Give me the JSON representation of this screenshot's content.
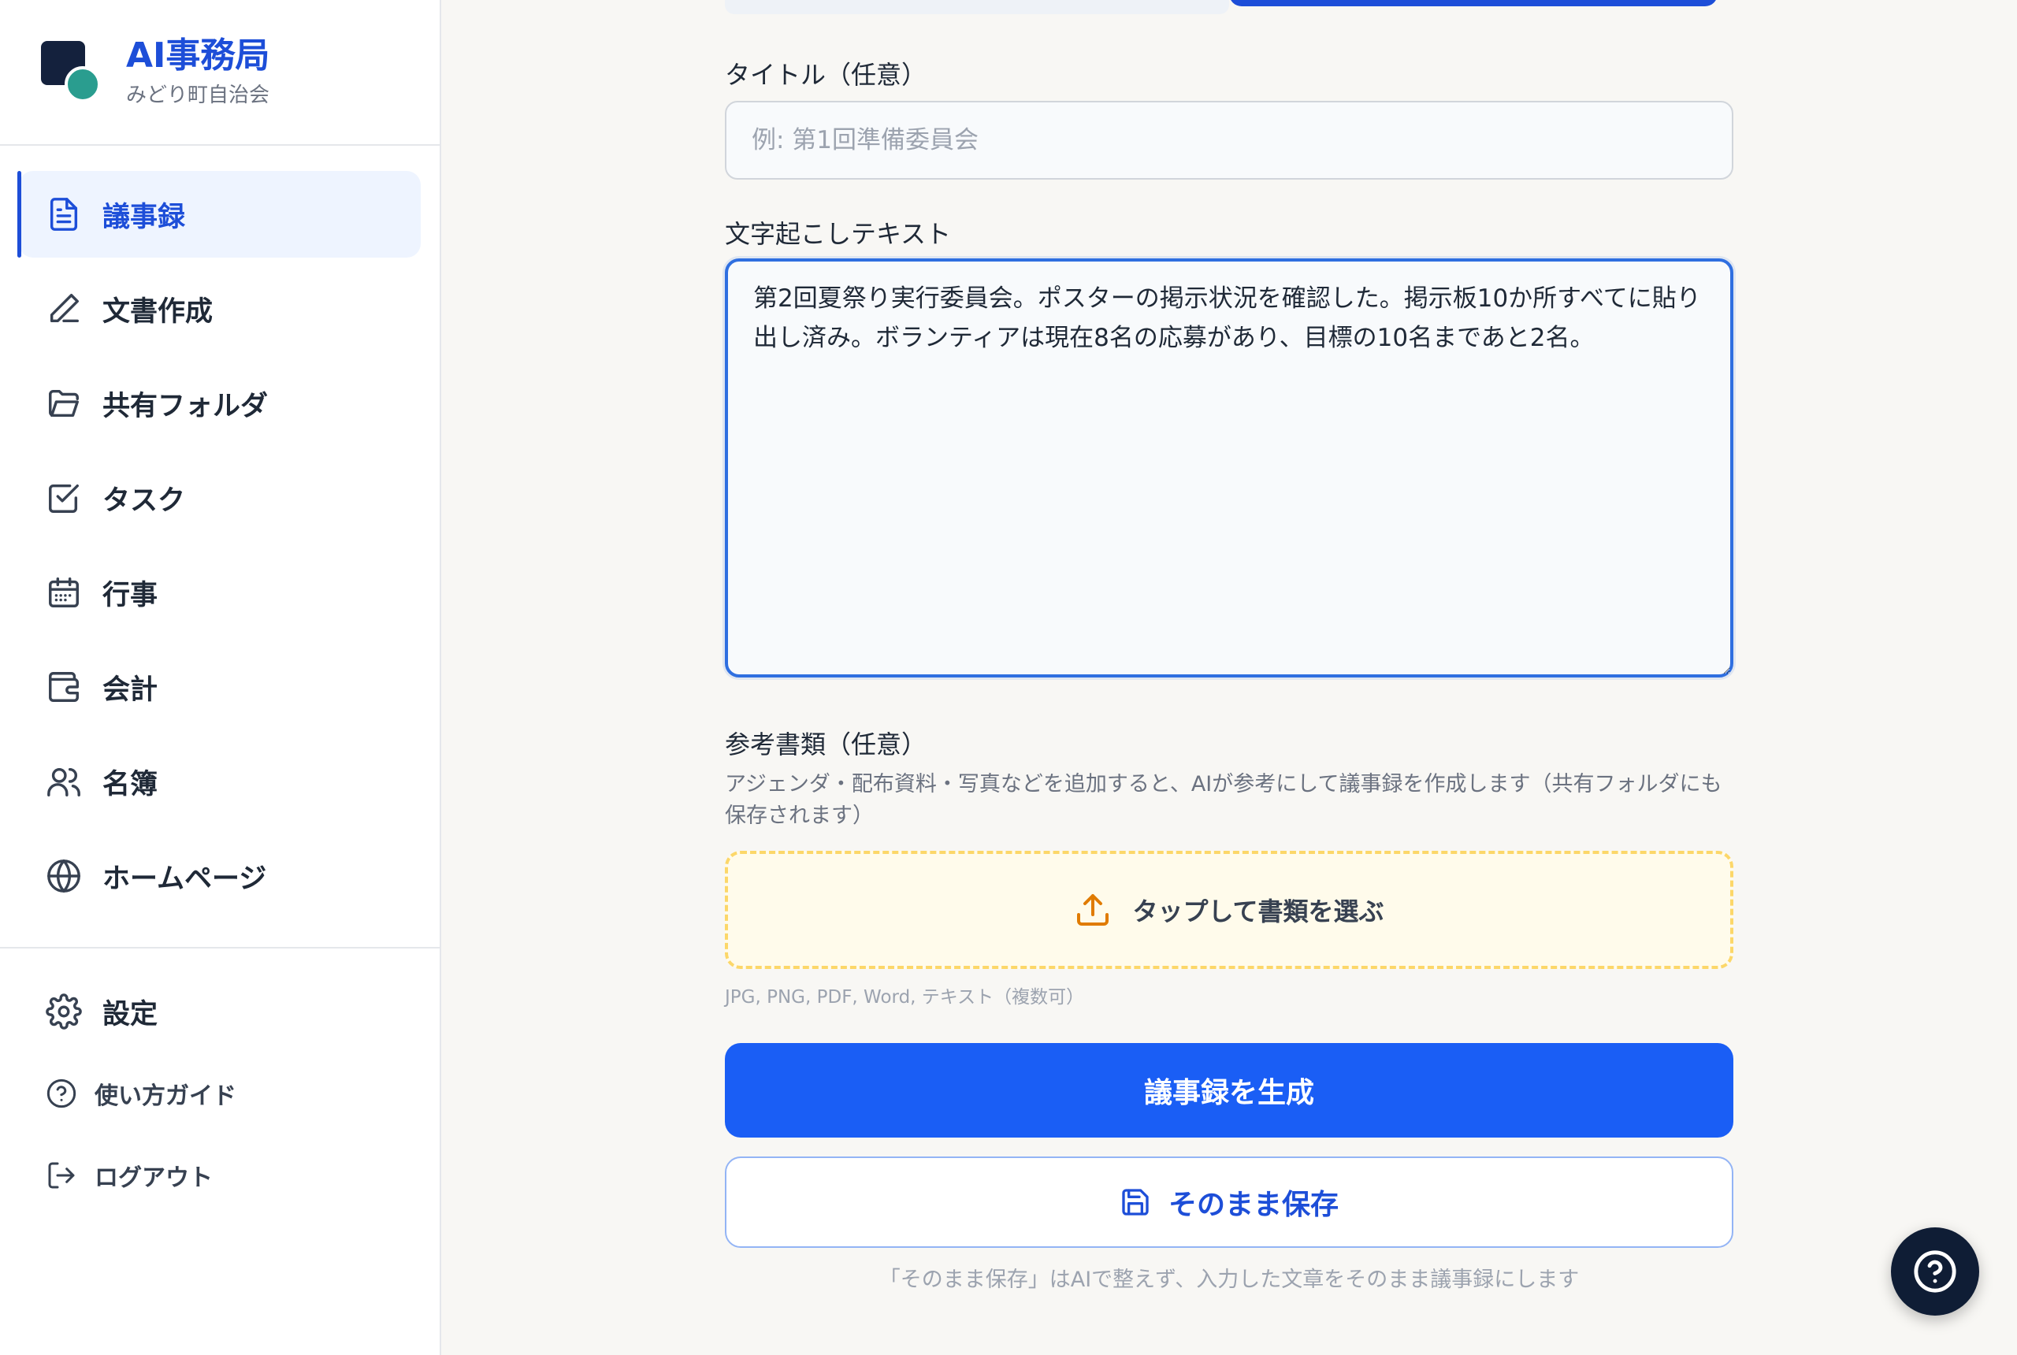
{
  "brand": {
    "title": "AI事務局",
    "subtitle": "みどり町自治会"
  },
  "sidebar": {
    "items": [
      {
        "label": "議事録",
        "icon": "document-icon",
        "active": true
      },
      {
        "label": "文書作成",
        "icon": "pencil-icon"
      },
      {
        "label": "共有フォルダ",
        "icon": "folder-icon"
      },
      {
        "label": "タスク",
        "icon": "checkbox-icon"
      },
      {
        "label": "行事",
        "icon": "calendar-icon"
      },
      {
        "label": "会計",
        "icon": "wallet-icon"
      },
      {
        "label": "名簿",
        "icon": "users-icon"
      },
      {
        "label": "ホームページ",
        "icon": "globe-icon"
      }
    ],
    "bottom": [
      {
        "label": "設定",
        "icon": "gear-icon"
      },
      {
        "label": "使い方ガイド",
        "icon": "help-circle-icon"
      },
      {
        "label": "ログアウト",
        "icon": "logout-icon"
      }
    ]
  },
  "form": {
    "title_label": "タイトル（任意）",
    "title_placeholder": "例: 第1回準備委員会",
    "title_value": "",
    "text_label": "文字起こしテキスト",
    "text_value": "第2回夏祭り実行委員会。ポスターの掲示状況を確認した。掲示板10か所すべてに貼り出し済み。ボランティアは現在8名の応募があり、目標の10名まであと2名。",
    "ref_label": "参考書類（任意）",
    "ref_description": "アジェンダ・配布資料・写真などを追加すると、AIが参考にして議事録を作成します（共有フォルダにも保存されます）",
    "dropzone_label": "タップして書類を選ぶ",
    "formats": "JPG, PNG, PDF, Word, テキスト（複数可）",
    "generate_button": "議事録を生成",
    "save_button": "そのまま保存",
    "save_note": "「そのまま保存」はAIで整えず、入力した文章をそのまま議事録にします"
  },
  "colors": {
    "accent": "#1a5ef5",
    "brand_blue": "#1d4ed8",
    "logo_dark": "#14213d",
    "logo_teal": "#2a9d8f",
    "upload_orange": "#e07b00"
  }
}
